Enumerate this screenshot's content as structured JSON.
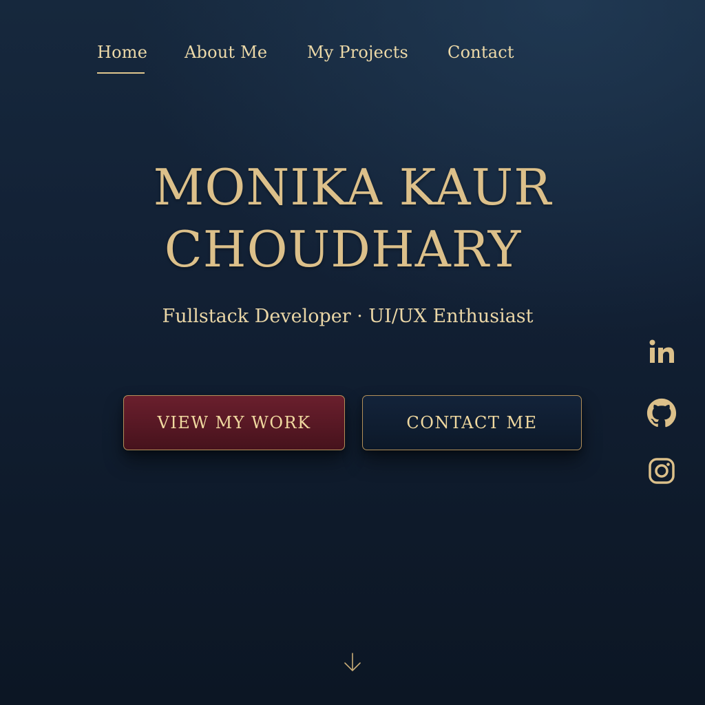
{
  "nav": {
    "items": [
      {
        "label": "Home",
        "active": true
      },
      {
        "label": "About Me"
      },
      {
        "label": "My Projects"
      },
      {
        "label": "Contact"
      }
    ]
  },
  "hero": {
    "name_line_1": "MONIKA KAUR",
    "name_line_2": "CHOUDHARY",
    "subtitle": "Fullstack Developer · UI/UX Enthusiast"
  },
  "buttons": {
    "primary_label": "VIEW MY WORK",
    "secondary_label": "CONTACT ME"
  },
  "social": [
    {
      "icon": "linkedin-icon"
    },
    {
      "icon": "github-icon"
    },
    {
      "icon": "instagram-icon"
    }
  ],
  "scroll": {
    "icon": "arrow-down-icon"
  },
  "colors": {
    "background": "#122034",
    "gold_accent": "#dcc08a",
    "primary_button": "#5a1a26",
    "secondary_button": "#0f1d30",
    "button_border": "#b4915a"
  }
}
